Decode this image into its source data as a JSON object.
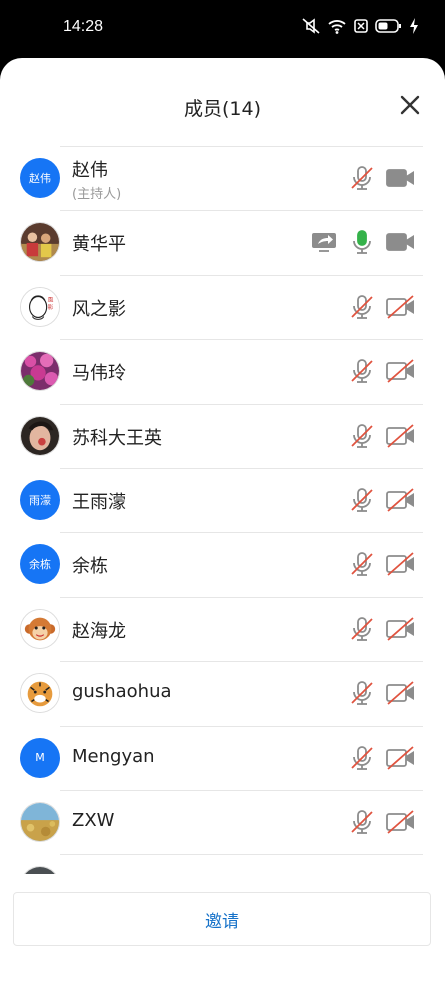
{
  "status_bar": {
    "time": "14:28"
  },
  "header": {
    "title": "成员(14)"
  },
  "members": [
    {
      "name": "赵伟",
      "sub": "(主持人)",
      "avatar_text": "赵伟",
      "avatar": "blue",
      "mic": "muted",
      "cam": "on"
    },
    {
      "name": "黄华平",
      "sub": "",
      "avatar_text": "",
      "avatar": "photo-people",
      "mic": "active",
      "cam": "on",
      "sharing": true
    },
    {
      "name": "风之影",
      "sub": "",
      "avatar_text": "",
      "avatar": "photo-sketch",
      "mic": "muted",
      "cam": "off"
    },
    {
      "name": "马伟玲",
      "sub": "",
      "avatar_text": "",
      "avatar": "photo-flowers",
      "mic": "muted",
      "cam": "off"
    },
    {
      "name": "苏科大王英",
      "sub": "",
      "avatar_text": "",
      "avatar": "photo-portrait",
      "mic": "muted",
      "cam": "off"
    },
    {
      "name": "王雨濛",
      "sub": "",
      "avatar_text": "雨濛",
      "avatar": "blue",
      "mic": "muted",
      "cam": "off"
    },
    {
      "name": "余栋",
      "sub": "",
      "avatar_text": "余栋",
      "avatar": "blue",
      "mic": "muted",
      "cam": "off"
    },
    {
      "name": "赵海龙",
      "sub": "",
      "avatar_text": "",
      "avatar": "photo-monkey",
      "mic": "muted",
      "cam": "off"
    },
    {
      "name": "gushaohua",
      "sub": "",
      "avatar_text": "",
      "avatar": "photo-tiger",
      "mic": "muted",
      "cam": "off"
    },
    {
      "name": "Mengyan",
      "sub": "",
      "avatar_text": "M",
      "avatar": "blue",
      "mic": "muted",
      "cam": "off"
    },
    {
      "name": "ZXW",
      "sub": "",
      "avatar_text": "",
      "avatar": "photo-field",
      "mic": "muted",
      "cam": "off"
    },
    {
      "name": "",
      "sub": "",
      "avatar_text": "",
      "avatar": "photo-dark",
      "mic": "muted",
      "cam": "off"
    }
  ],
  "invite": {
    "label": "邀请"
  },
  "colors": {
    "accent": "#1675f5",
    "invite_text": "#1672c9",
    "muted_red": "#e0533f",
    "icon_gray": "#8c8c8c",
    "mic_active": "#35b24a"
  }
}
